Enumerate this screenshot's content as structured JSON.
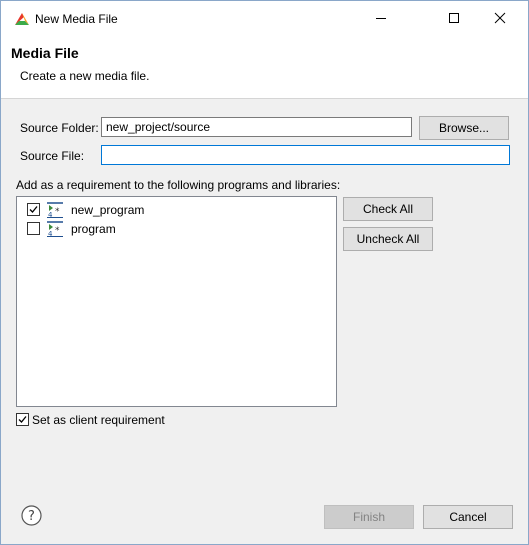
{
  "window": {
    "title": "New Media File",
    "controls": {
      "minimize": "minimize",
      "maximize": "maximize",
      "close": "close"
    }
  },
  "banner": {
    "title": "Media File",
    "description": "Create a new media file."
  },
  "form": {
    "source_folder_label": "Source Folder:",
    "source_folder_value": "new_project/source",
    "browse_label": "Browse...",
    "source_file_label": "Source File:",
    "source_file_value": ""
  },
  "requirements": {
    "label": "Add as a requirement to the following programs and libraries:",
    "items": [
      {
        "label": "new_program",
        "checked": true,
        "icon": "program-icon"
      },
      {
        "label": "program",
        "checked": false,
        "icon": "program-icon"
      }
    ],
    "check_all_label": "Check All",
    "uncheck_all_label": "Uncheck All",
    "client_requirement_label": "Set as client requirement",
    "client_requirement_checked": true
  },
  "footer": {
    "help_icon": "question-mark-icon",
    "finish_label": "Finish",
    "finish_enabled": false,
    "cancel_label": "Cancel"
  },
  "colors": {
    "focus_border": "#0078d7",
    "window_border": "#8aa7c9"
  }
}
